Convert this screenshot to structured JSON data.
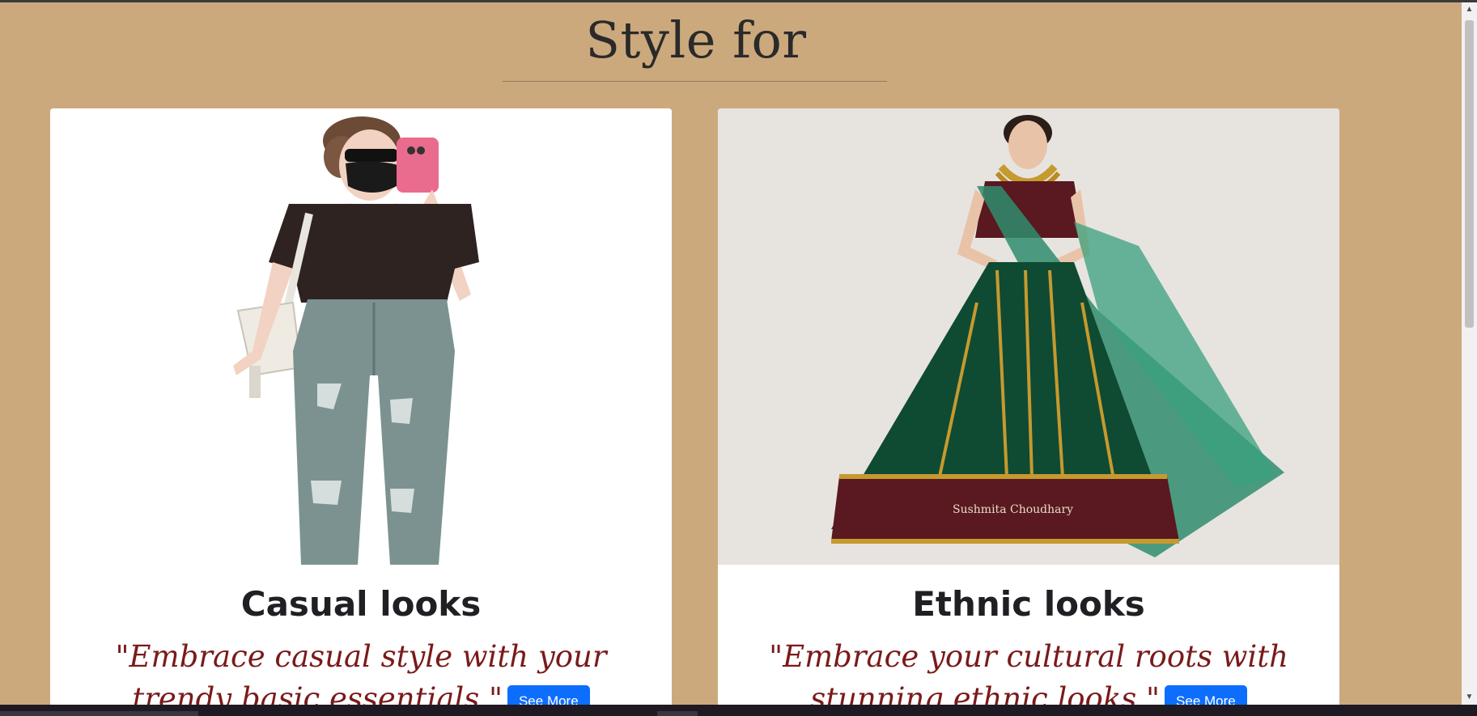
{
  "section": {
    "heading": "Style for"
  },
  "cards": [
    {
      "title": "Casual looks",
      "text": "\"Embrace casual style with your trendy basic essentials.\"",
      "button_label": "See More",
      "image_icon": "casual-outfit-illustration"
    },
    {
      "title": "Ethnic looks",
      "text": "\"Embrace your cultural roots with stunning ethnic looks.\"",
      "button_label": "See More",
      "image_icon": "ethnic-lehenga-illustration",
      "image_signature": "Sushmita Choudhary"
    }
  ],
  "colors": {
    "background": "#cca97d",
    "card": "#ffffff",
    "quote_text": "#7a1a1a",
    "button": "#0d6efd"
  }
}
